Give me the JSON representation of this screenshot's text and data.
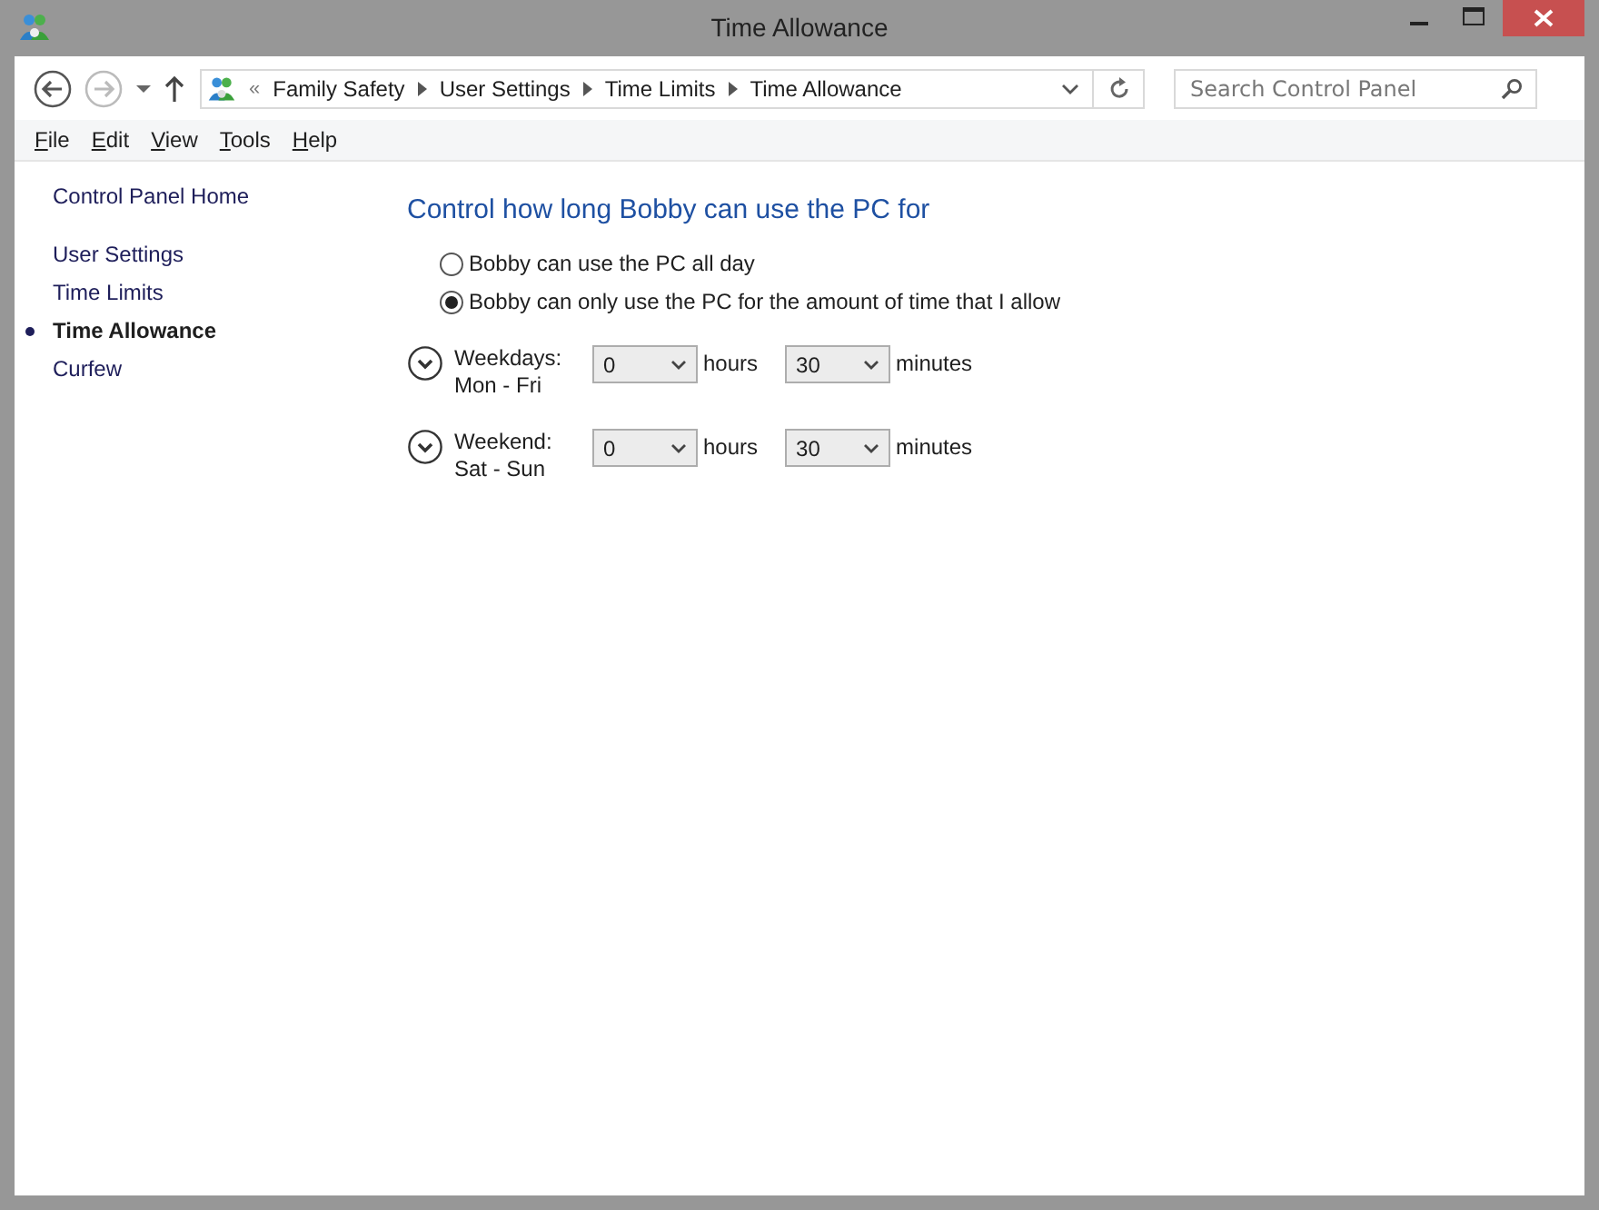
{
  "window": {
    "title": "Time Allowance"
  },
  "address_bar": {
    "overflow": "«",
    "crumbs": [
      "Family Safety",
      "User Settings",
      "Time Limits",
      "Time Allowance"
    ]
  },
  "search": {
    "placeholder": "Search Control Panel"
  },
  "menu": [
    "File",
    "Edit",
    "View",
    "Tools",
    "Help"
  ],
  "sidebar": {
    "home": "Control Panel Home",
    "items": [
      {
        "label": "User Settings",
        "selected": false
      },
      {
        "label": "Time Limits",
        "selected": false
      },
      {
        "label": "Time Allowance",
        "selected": true
      },
      {
        "label": "Curfew",
        "selected": false
      }
    ]
  },
  "heading": "Control how long Bobby can use the PC for",
  "options": [
    {
      "label": "Bobby can use the PC all day",
      "selected": false
    },
    {
      "label": "Bobby can only use the PC for the amount of time that I allow",
      "selected": true
    }
  ],
  "schedules": [
    {
      "label": "Weekdays:",
      "days": "Mon - Fri",
      "hours": "0",
      "hours_unit": "hours",
      "minutes": "30",
      "minutes_unit": "minutes"
    },
    {
      "label": "Weekend:",
      "days": "Sat - Sun",
      "hours": "0",
      "hours_unit": "hours",
      "minutes": "30",
      "minutes_unit": "minutes"
    }
  ]
}
